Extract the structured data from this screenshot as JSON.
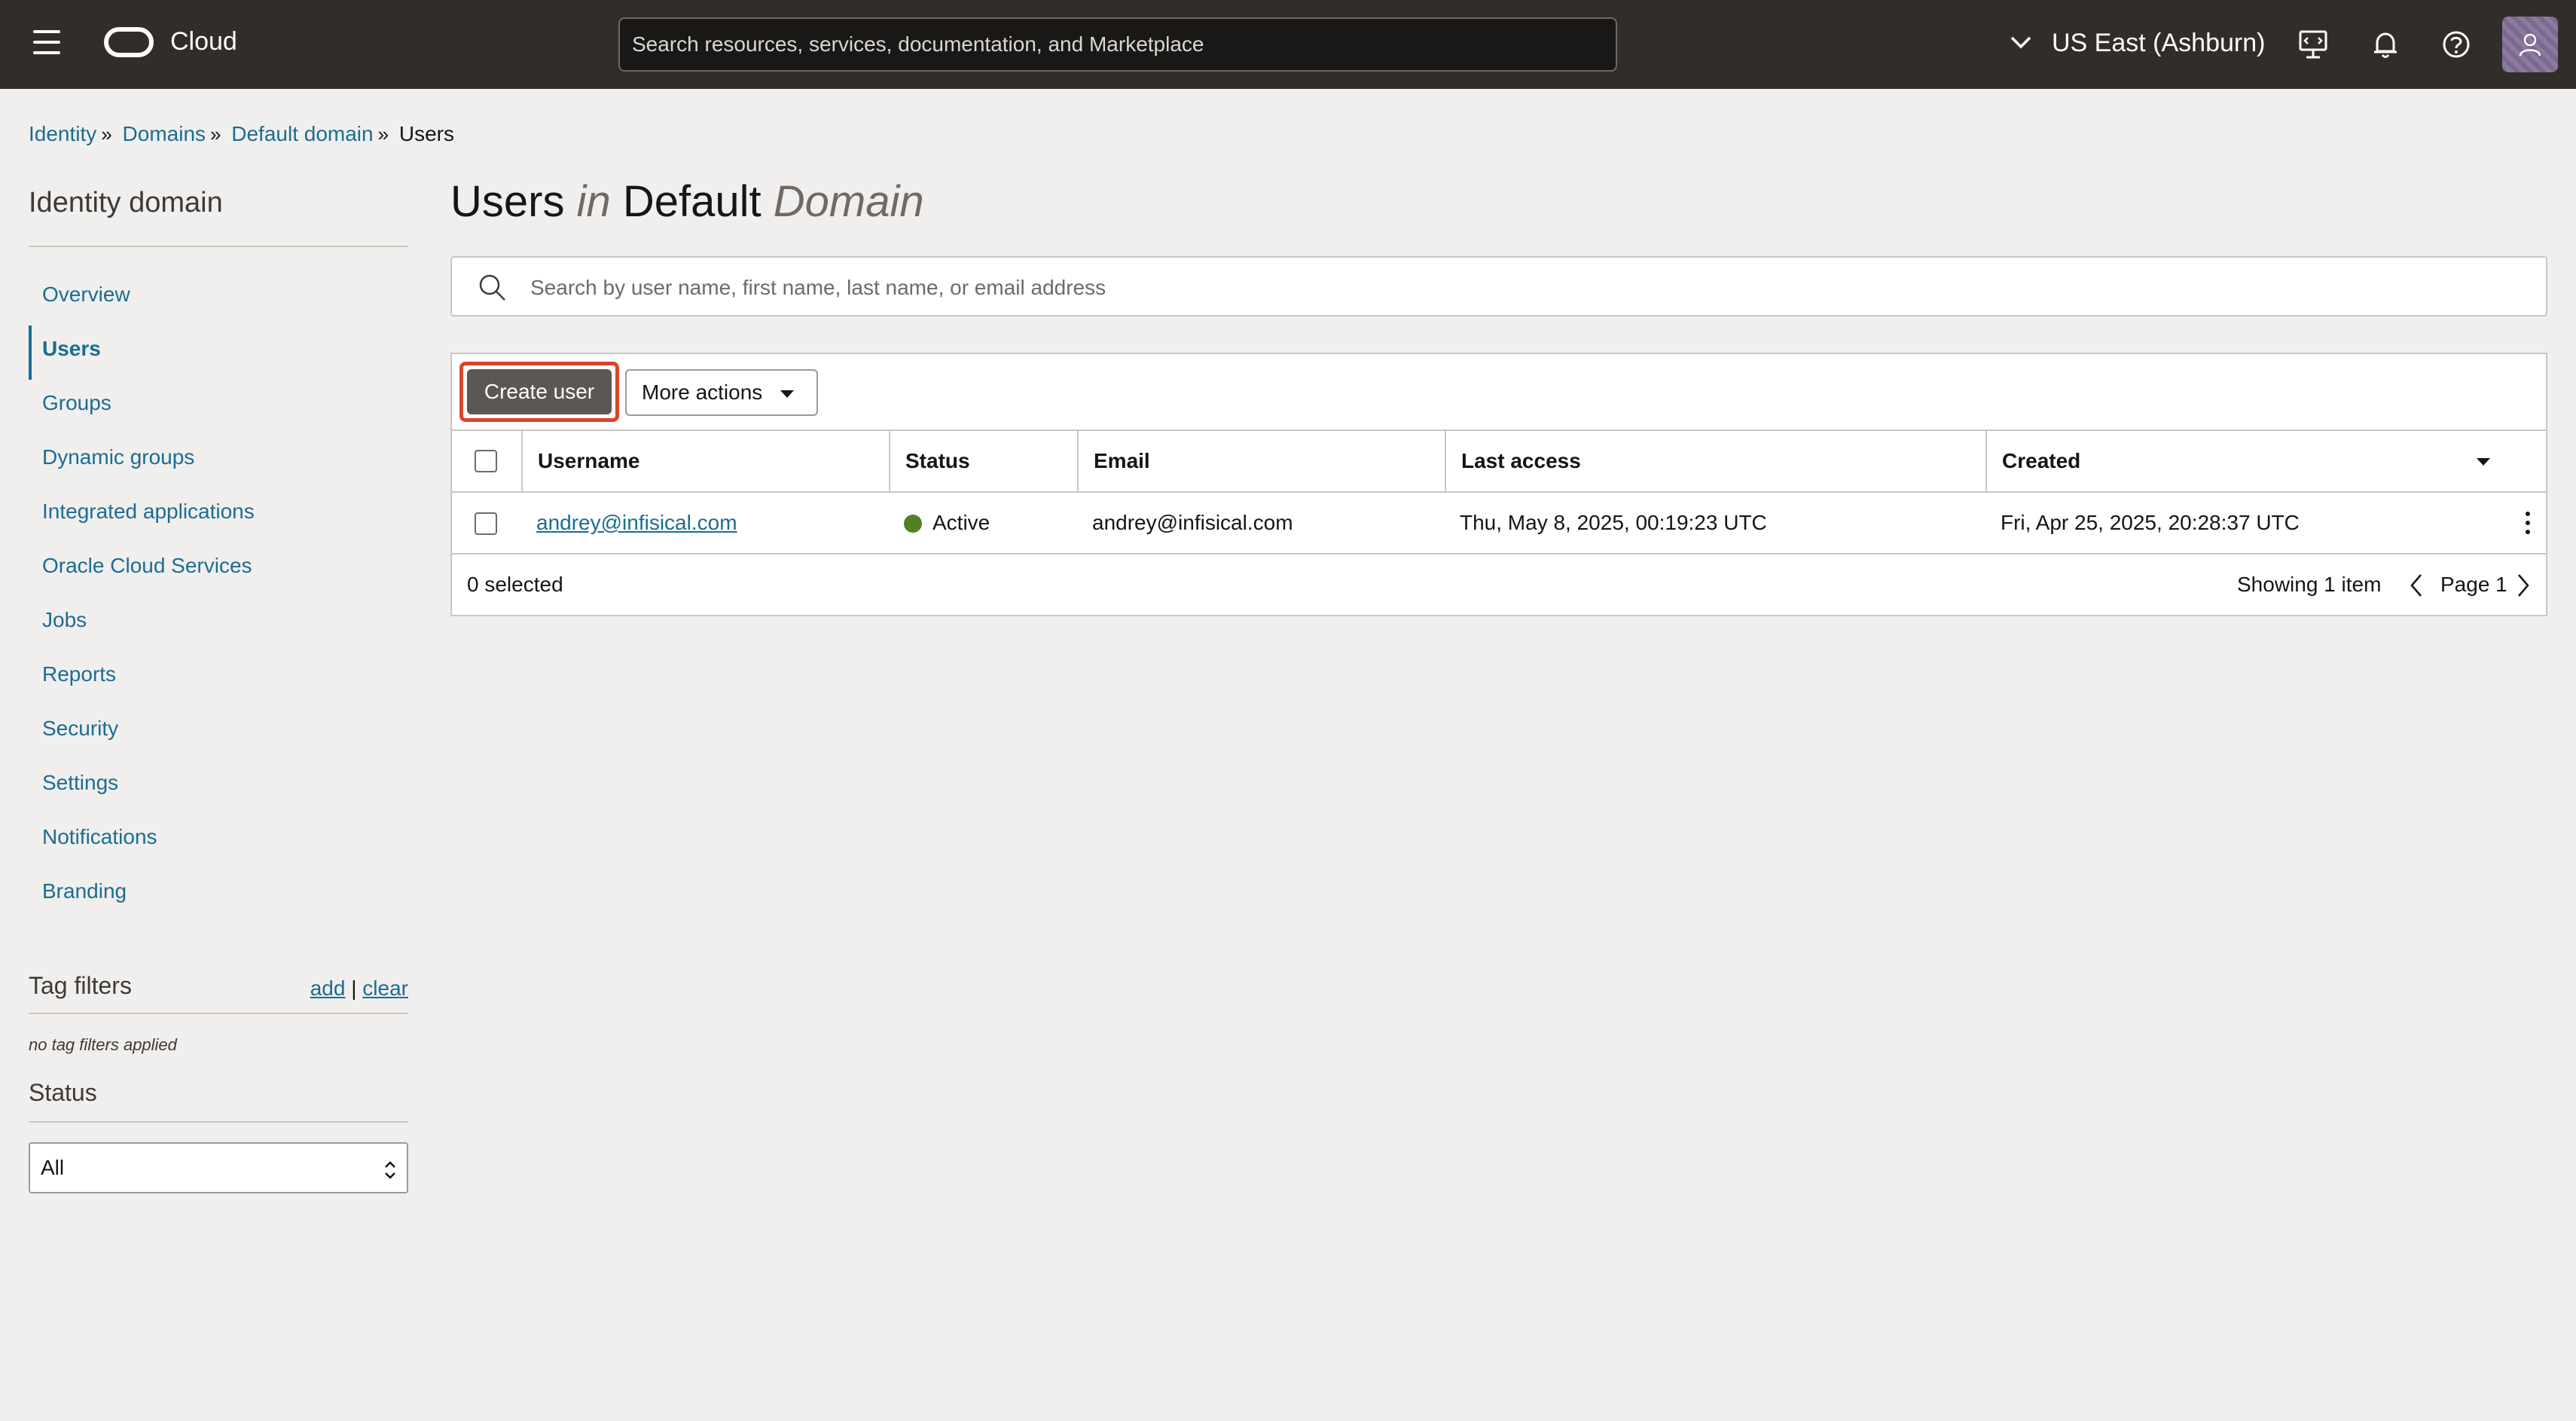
{
  "header": {
    "brand": "Cloud",
    "search_placeholder": "Search resources, services, documentation, and Marketplace",
    "region": "US East (Ashburn)"
  },
  "breadcrumb": [
    "Identity",
    "Domains",
    "Default domain",
    "Users"
  ],
  "sidebar": {
    "title": "Identity domain",
    "items": [
      {
        "label": "Overview",
        "active": false
      },
      {
        "label": "Users",
        "active": true
      },
      {
        "label": "Groups",
        "active": false
      },
      {
        "label": "Dynamic groups",
        "active": false
      },
      {
        "label": "Integrated applications",
        "active": false
      },
      {
        "label": "Oracle Cloud Services",
        "active": false
      },
      {
        "label": "Jobs",
        "active": false
      },
      {
        "label": "Reports",
        "active": false
      },
      {
        "label": "Security",
        "active": false
      },
      {
        "label": "Settings",
        "active": false
      },
      {
        "label": "Notifications",
        "active": false
      },
      {
        "label": "Branding",
        "active": false
      }
    ],
    "tag_filters": {
      "title": "Tag filters",
      "add": "add",
      "separator": "|",
      "clear": "clear",
      "note": "no tag filters applied"
    },
    "status_filter": {
      "title": "Status",
      "selected": "All"
    }
  },
  "main": {
    "title": {
      "part1": "Users",
      "part2": "in",
      "part3": "Default",
      "part4": "Domain"
    },
    "search_placeholder": "Search by user name, first name, last name, or email address",
    "create_button": "Create user",
    "more_actions": "More actions",
    "columns": [
      "Username",
      "Status",
      "Email",
      "Last access",
      "Created"
    ],
    "rows": [
      {
        "username": "andrey@infisical.com",
        "status": "Active",
        "email": "andrey@infisical.com",
        "last_access": "Thu, May 8, 2025, 00:19:23 UTC",
        "created": "Fri, Apr 25, 2025, 20:28:37 UTC"
      }
    ],
    "footer": {
      "selected": "0 selected",
      "showing": "Showing 1 item",
      "page": "Page 1"
    }
  },
  "colors": {
    "header_bg": "#312d2a",
    "link": "#1a6d94",
    "status_active": "#508223",
    "highlight": "#d9452b",
    "primary_button": "#5c5753"
  }
}
